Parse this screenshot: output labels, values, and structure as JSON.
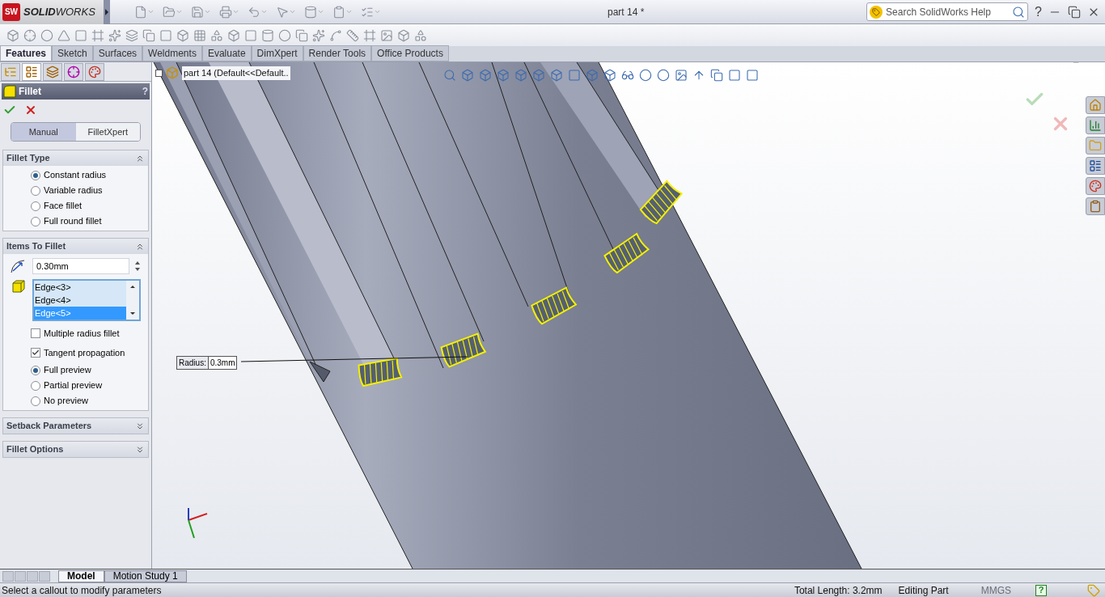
{
  "app": {
    "badge": "SW",
    "logo_bold": "SOLID",
    "logo_rest": "WORKS"
  },
  "window": {
    "title": "part 14 *"
  },
  "help_search": {
    "placeholder": "Search SolidWorks Help"
  },
  "help_button": "?",
  "command_tabs": [
    {
      "label": "Features",
      "selected": true
    },
    {
      "label": "Sketch",
      "selected": false
    },
    {
      "label": "Surfaces",
      "selected": false
    },
    {
      "label": "Weldments",
      "selected": false
    },
    {
      "label": "Evaluate",
      "selected": false
    },
    {
      "label": "DimXpert",
      "selected": false
    },
    {
      "label": "Render Tools",
      "selected": false
    },
    {
      "label": "Office Products",
      "selected": false
    }
  ],
  "panel_tabs": [
    {
      "kind": "tree",
      "selected": false
    },
    {
      "kind": "property",
      "selected": true
    },
    {
      "kind": "config",
      "selected": false
    },
    {
      "kind": "dimxpert",
      "selected": false
    },
    {
      "kind": "appearance",
      "selected": false
    }
  ],
  "property_manager": {
    "title": "Fillet",
    "help": "?",
    "modes": [
      {
        "label": "Manual",
        "selected": true
      },
      {
        "label": "FilletXpert",
        "selected": false
      }
    ],
    "sections": [
      {
        "title": "Fillet Type",
        "expanded": true,
        "controls": [
          {
            "kind": "radio",
            "label": "Constant radius",
            "checked": true
          },
          {
            "kind": "radio",
            "label": "Variable radius",
            "checked": false
          },
          {
            "kind": "radio",
            "label": "Face fillet",
            "checked": false
          },
          {
            "kind": "radio",
            "label": "Full round fillet",
            "checked": false
          }
        ]
      },
      {
        "title": "Items To Fillet",
        "expanded": true,
        "controls": [
          {
            "kind": "radius",
            "value": "0.30mm"
          },
          {
            "kind": "edges",
            "items": [
              {
                "label": "Edge<3>",
                "selected": false
              },
              {
                "label": "Edge<4>",
                "selected": false
              },
              {
                "label": "Edge<5>",
                "selected": true
              }
            ]
          },
          {
            "kind": "checkbox",
            "label": "Multiple radius fillet",
            "checked": false
          },
          {
            "kind": "checkbox",
            "label": "Tangent propagation",
            "checked": true
          },
          {
            "kind": "radio",
            "label": "Full preview",
            "checked": true
          },
          {
            "kind": "radio",
            "label": "Partial preview",
            "checked": false
          },
          {
            "kind": "radio",
            "label": "No preview",
            "checked": false
          }
        ]
      },
      {
        "title": "Setback Parameters",
        "expanded": false
      },
      {
        "title": "Fillet Options",
        "expanded": false
      }
    ]
  },
  "feature_tree": {
    "label": "part 14  (Default<<Default.."
  },
  "callout": {
    "label": "Radius:",
    "value": "0.3mm"
  },
  "bottom_tabs": [
    {
      "label": "Model",
      "selected": true
    },
    {
      "label": "Motion Study 1",
      "selected": false
    }
  ],
  "status_bar": {
    "message": "Select a callout to modify parameters",
    "total_length": "Total Length: 3.2mm",
    "mode": "Editing Part",
    "units": "MMGS",
    "help": "?"
  }
}
